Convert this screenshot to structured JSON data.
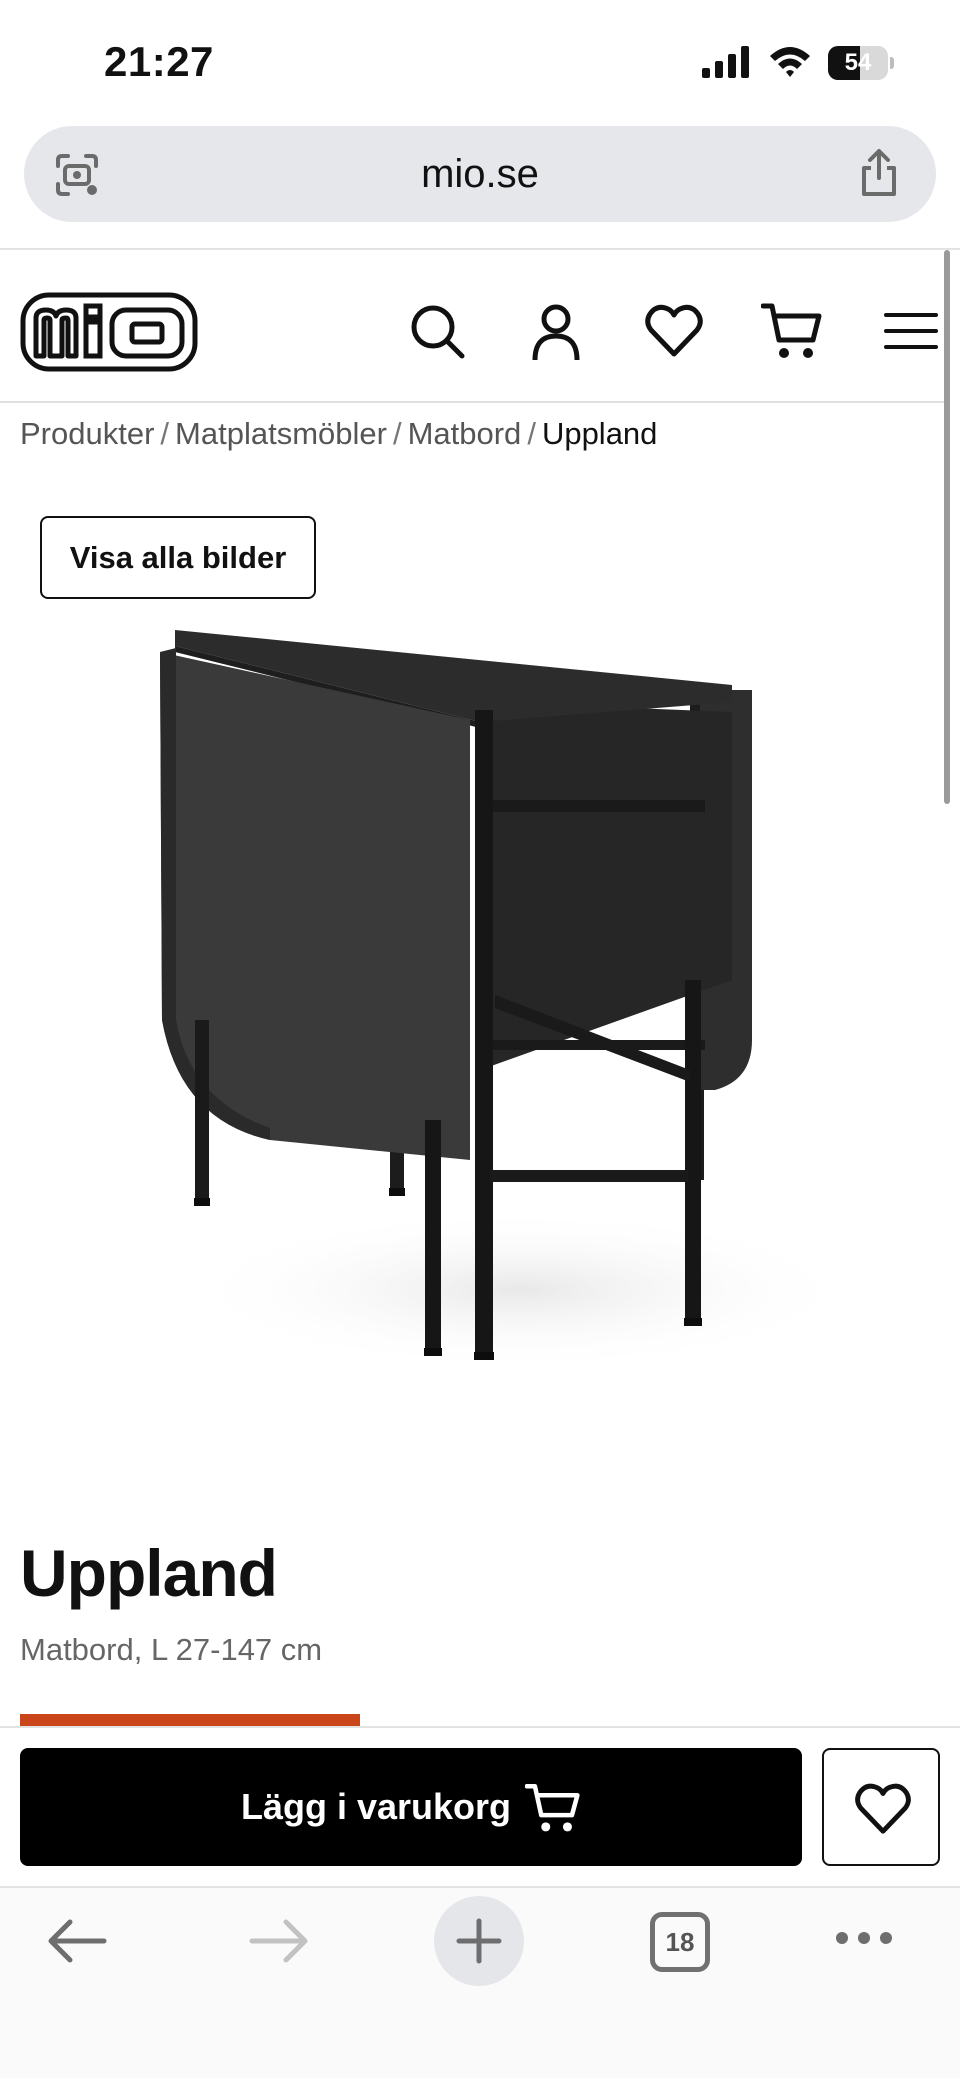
{
  "status_bar": {
    "time": "21:27",
    "battery": "54",
    "battery_level": 0.54
  },
  "browser": {
    "url": "mio.se",
    "tabs_count": "18"
  },
  "site": {
    "logo_text": "mio",
    "header_icons": [
      "search-icon",
      "account-icon",
      "heart-icon",
      "cart-icon",
      "menu-icon"
    ]
  },
  "breadcrumb": {
    "items": [
      "Produkter",
      "Matplatsmöbler",
      "Matbord"
    ],
    "separator": "/",
    "current": "Uppland"
  },
  "gallery": {
    "show_all_label": "Visa alla bilder"
  },
  "product": {
    "title": "Uppland",
    "subtitle": "Matbord, L 27-147 cm"
  },
  "actions": {
    "add_to_cart_label": "Lägg i varukorg"
  },
  "colors": {
    "accent": "#c9461a",
    "primary_button": "#000000",
    "url_bar": "#e5e7ea"
  }
}
